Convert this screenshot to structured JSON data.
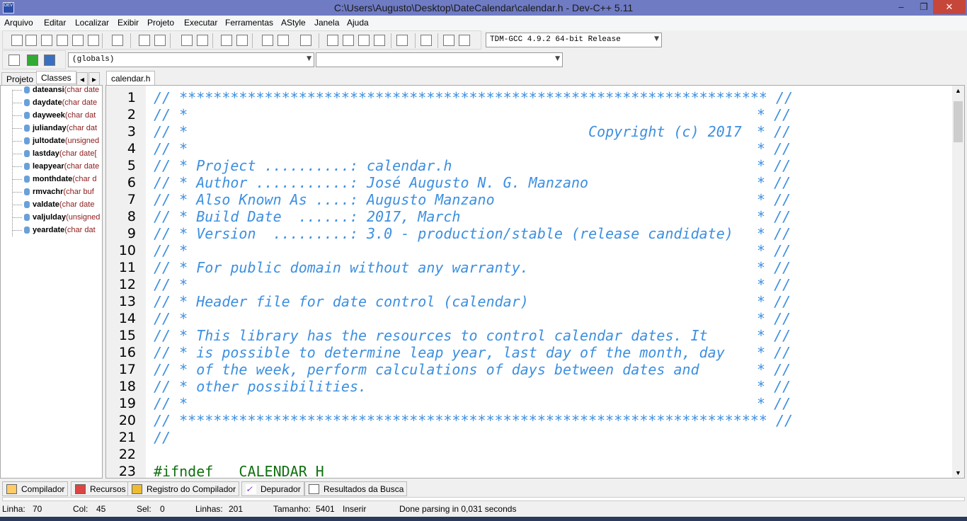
{
  "window": {
    "title": "C:\\Users\\Augusto\\Desktop\\DateCalendar\\calendar.h - Dev-C++ 5.11",
    "icon": "dev-cpp-icon"
  },
  "menu": [
    "Arquivo",
    "Editar",
    "Localizar",
    "Exibir",
    "Projeto",
    "Executar",
    "Ferramentas",
    "AStyle",
    "Janela",
    "Ajuda"
  ],
  "toolbar": {
    "compiler_select": "TDM-GCC 4.9.2 64-bit Release",
    "scope_select": "(globals)",
    "member_select": ""
  },
  "left_tabs": [
    "Projeto",
    "Classes"
  ],
  "classes": [
    {
      "name": "dateansi",
      "sig": "(char date"
    },
    {
      "name": "daydate",
      "sig": "(char date"
    },
    {
      "name": "dayweek",
      "sig": "(char dat"
    },
    {
      "name": "julianday",
      "sig": "(char dat"
    },
    {
      "name": "jultodate",
      "sig": "(unsigned"
    },
    {
      "name": "lastday",
      "sig": "(char date["
    },
    {
      "name": "leapyear",
      "sig": "(char date"
    },
    {
      "name": "monthdate",
      "sig": "(char d"
    },
    {
      "name": "rmvachr",
      "sig": "(char buf"
    },
    {
      "name": "valdate",
      "sig": "(char date"
    },
    {
      "name": "valjulday",
      "sig": "(unsigned"
    },
    {
      "name": "yeardate",
      "sig": "(char dat"
    }
  ],
  "editor": {
    "file_tab": "calendar.h",
    "lines": [
      {
        "n": "1",
        "text": "// ********************************************************************* //",
        "end": "",
        "kind": "cm"
      },
      {
        "n": "2",
        "text": "// *",
        "end": "* //",
        "kind": "cm"
      },
      {
        "n": "3",
        "text": "// *                                               Copyright (c) 2017",
        "end": "* //",
        "kind": "cm"
      },
      {
        "n": "4",
        "text": "// *",
        "end": "* //",
        "kind": "cm"
      },
      {
        "n": "5",
        "text": "// * Project ..........: calendar.h",
        "end": "* //",
        "kind": "cm"
      },
      {
        "n": "6",
        "text": "// * Author ...........: José Augusto N. G. Manzano",
        "end": "* //",
        "kind": "cm"
      },
      {
        "n": "7",
        "text": "// * Also Known As ....: Augusto Manzano",
        "end": "* //",
        "kind": "cm"
      },
      {
        "n": "8",
        "text": "// * Build Date  ......: 2017, March",
        "end": "* //",
        "kind": "cm"
      },
      {
        "n": "9",
        "text": "// * Version  .........: 3.0 - production/stable (release candidate)",
        "end": "* //",
        "kind": "cm"
      },
      {
        "n": "10",
        "text": "// *",
        "end": "* //",
        "kind": "cm"
      },
      {
        "n": "11",
        "text": "// * For public domain without any warranty.",
        "end": "* //",
        "kind": "cm"
      },
      {
        "n": "12",
        "text": "// *",
        "end": "* //",
        "kind": "cm"
      },
      {
        "n": "13",
        "text": "// * Header file for date control (calendar)",
        "end": "* //",
        "kind": "cm"
      },
      {
        "n": "14",
        "text": "// *",
        "end": "* //",
        "kind": "cm"
      },
      {
        "n": "15",
        "text": "// * This library has the resources to control calendar dates. It",
        "end": "* //",
        "kind": "cm"
      },
      {
        "n": "16",
        "text": "// * is possible to determine leap year, last day of the month, day",
        "end": "* //",
        "kind": "cm"
      },
      {
        "n": "17",
        "text": "// * of the week, perform calculations of days between dates and",
        "end": "* //",
        "kind": "cm"
      },
      {
        "n": "18",
        "text": "// * other possibilities.",
        "end": "* //",
        "kind": "cm"
      },
      {
        "n": "19",
        "text": "// *",
        "end": "* //",
        "kind": "cm"
      },
      {
        "n": "20",
        "text": "// ********************************************************************* //",
        "end": "",
        "kind": "cm"
      },
      {
        "n": "21",
        "text": "//",
        "end": "",
        "kind": "cm"
      },
      {
        "n": "22",
        "text": "",
        "end": "",
        "kind": "cm"
      },
      {
        "n": "23",
        "text": "#ifndef   CALENDAR_H",
        "end": "",
        "kind": "pp"
      }
    ]
  },
  "bottom_tabs": [
    "Compilador",
    "Recursos",
    "Registro do Compilador",
    "Depurador",
    "Resultados da Busca"
  ],
  "status": {
    "linha_label": "Linha:",
    "linha": "70",
    "col_label": "Col:",
    "col": "45",
    "sel_label": "Sel:",
    "sel": "0",
    "linhas_label": "Linhas:",
    "linhas": "201",
    "tamanho_label": "Tamanho:",
    "tamanho": "5401",
    "mode": "Inserir",
    "message": "Done parsing in 0,031 seconds"
  },
  "colors": {
    "comment": "#3c8fe0",
    "preprocessor": "#107010",
    "titlebar": "#6f7bc3"
  }
}
